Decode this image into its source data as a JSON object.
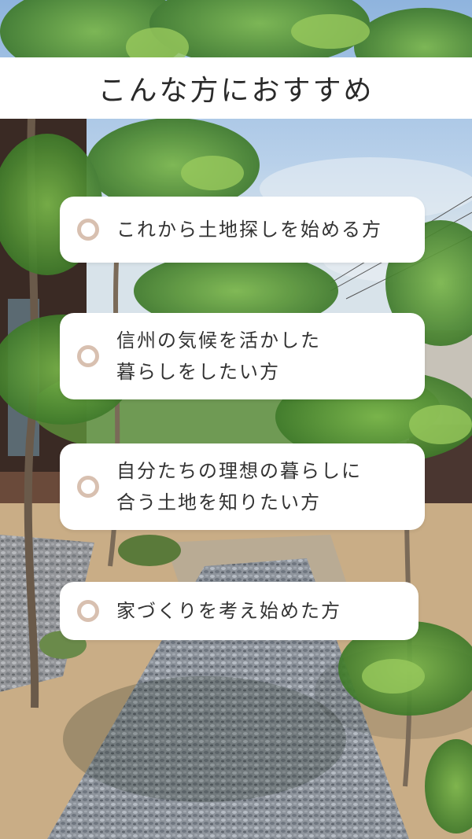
{
  "header": {
    "title": "こんな方におすすめ"
  },
  "items": [
    {
      "lines": [
        "これから土地探しを始める方"
      ]
    },
    {
      "lines": [
        "信州の気候を活かした",
        "暮らしをしたい方"
      ]
    },
    {
      "lines": [
        "自分たちの理想の暮らしに",
        "合う土地を知りたい方"
      ]
    },
    {
      "lines": [
        "家づくりを考え始めた方"
      ]
    }
  ],
  "colors": {
    "ring": "#d8c0b0",
    "card": "#ffffff",
    "text": "#333333"
  }
}
